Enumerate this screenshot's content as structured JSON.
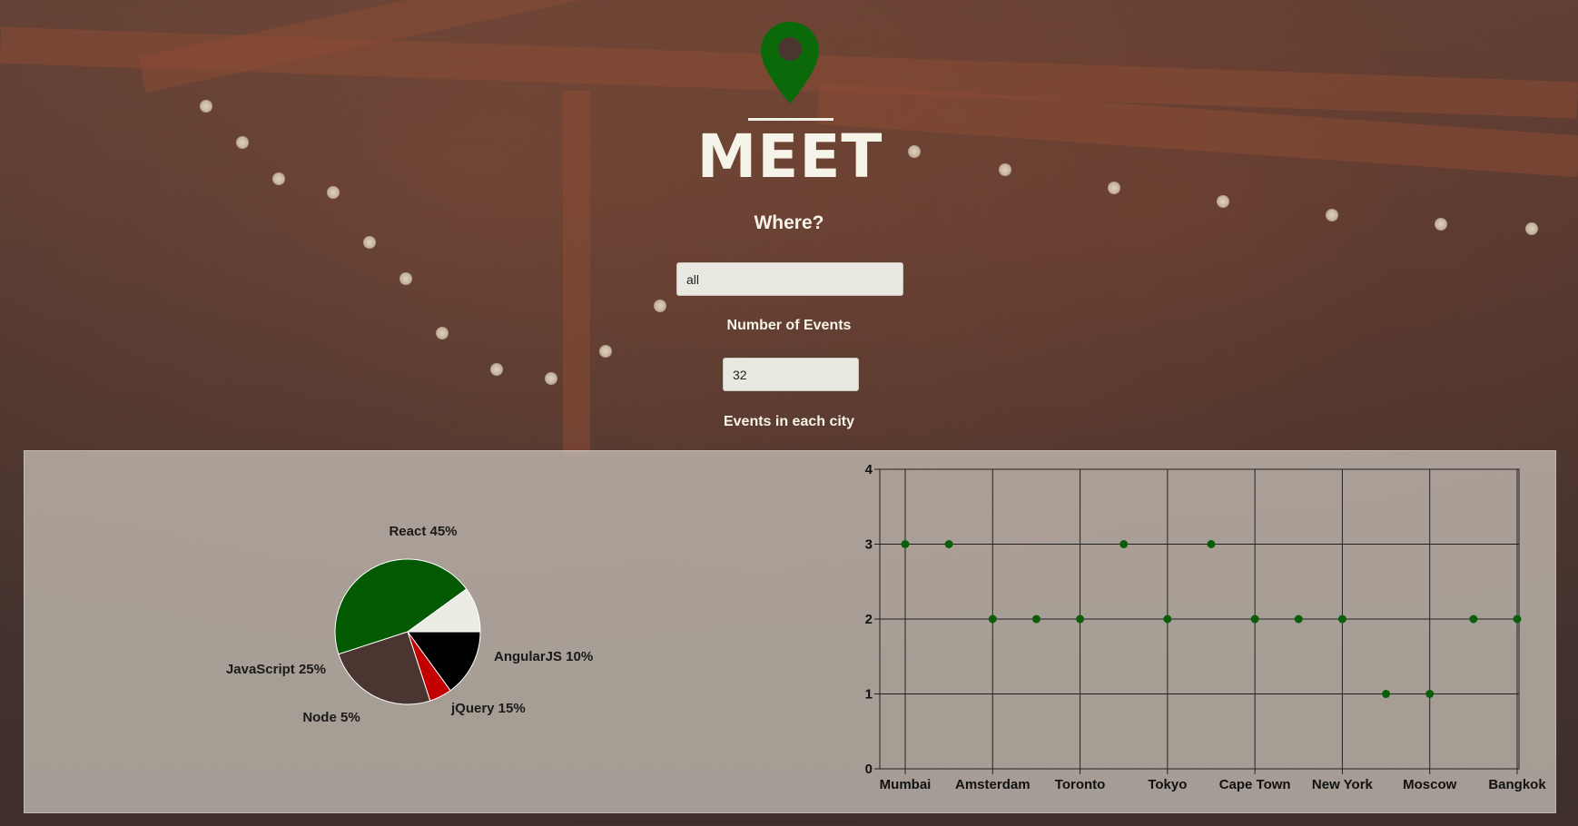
{
  "app": {
    "title": "MEET",
    "where_label": "Where?",
    "number_label": "Number of Events",
    "chart_heading": "Events in each city"
  },
  "search": {
    "value": "all"
  },
  "events": {
    "value": "32"
  },
  "colors": {
    "brand_green": "#0a5e0a",
    "react": "#035a03",
    "angular": "#ecece4",
    "jquery": "#000000",
    "node": "#c20000",
    "javascript": "#4a3530"
  },
  "icons": {
    "logo": "location-pin-icon"
  },
  "chart_data": [
    {
      "type": "pie",
      "slices": [
        {
          "label": "React 45%",
          "value": 45,
          "color": "#035a03"
        },
        {
          "label": "AngularJS 10%",
          "value": 10,
          "color": "#ecece4"
        },
        {
          "label": "jQuery 15%",
          "value": 15,
          "color": "#000000"
        },
        {
          "label": "Node 5%",
          "value": 5,
          "color": "#c20000"
        },
        {
          "label": "JavaScript 25%",
          "value": 25,
          "color": "#4a3530"
        }
      ]
    },
    {
      "type": "scatter",
      "x": [
        "Mumbai",
        "",
        "Amsterdam",
        "",
        "Toronto",
        "",
        "Tokyo",
        "",
        "Cape Town",
        "",
        "New York",
        "",
        "Moscow",
        "",
        "Bangkok"
      ],
      "x_tick_labels": [
        "Mumbai",
        "Amsterdam",
        "Toronto",
        "Tokyo",
        "Cape Town",
        "New York",
        "Moscow",
        "Bangkok"
      ],
      "y": [
        3,
        3,
        2,
        2,
        2,
        3,
        2,
        3,
        2,
        2,
        2,
        1,
        1,
        2,
        2
      ],
      "ylim": [
        0,
        4
      ],
      "y_ticks": [
        0,
        1,
        2,
        3,
        4
      ],
      "grid": true,
      "point_color": "#0a5e0a"
    }
  ]
}
